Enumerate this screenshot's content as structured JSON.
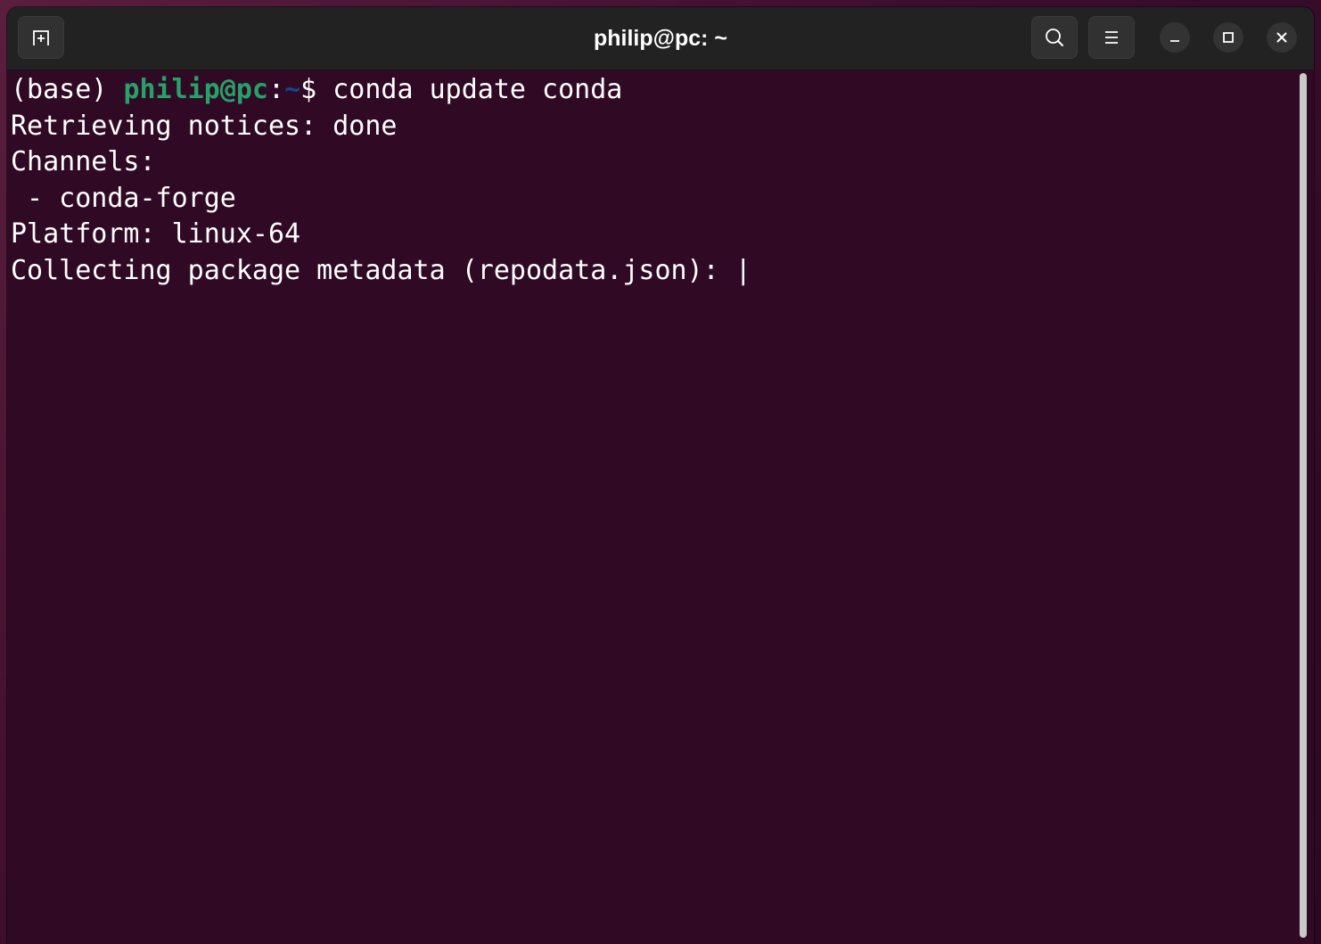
{
  "window": {
    "title": "philip@pc: ~"
  },
  "icons": {
    "new_tab": "new-tab-icon",
    "search": "search-icon",
    "menu": "hamburger-menu-icon",
    "minimize": "minimize-icon",
    "maximize": "maximize-icon",
    "close": "close-icon"
  },
  "terminal": {
    "prompt": {
      "env": "(base) ",
      "user_host": "philip@pc",
      "colon": ":",
      "path": "~",
      "symbol": "$ ",
      "command": "conda update conda"
    },
    "output": [
      "Retrieving notices: done",
      "Channels:",
      " - conda-forge",
      "Platform: linux-64",
      "Collecting package metadata (repodata.json): |"
    ]
  },
  "colors": {
    "terminal_background": "#300a24",
    "titlebar_background": "#222222",
    "prompt_user_host": "#26a269",
    "prompt_path": "#12488b",
    "text": "#ffffff"
  }
}
